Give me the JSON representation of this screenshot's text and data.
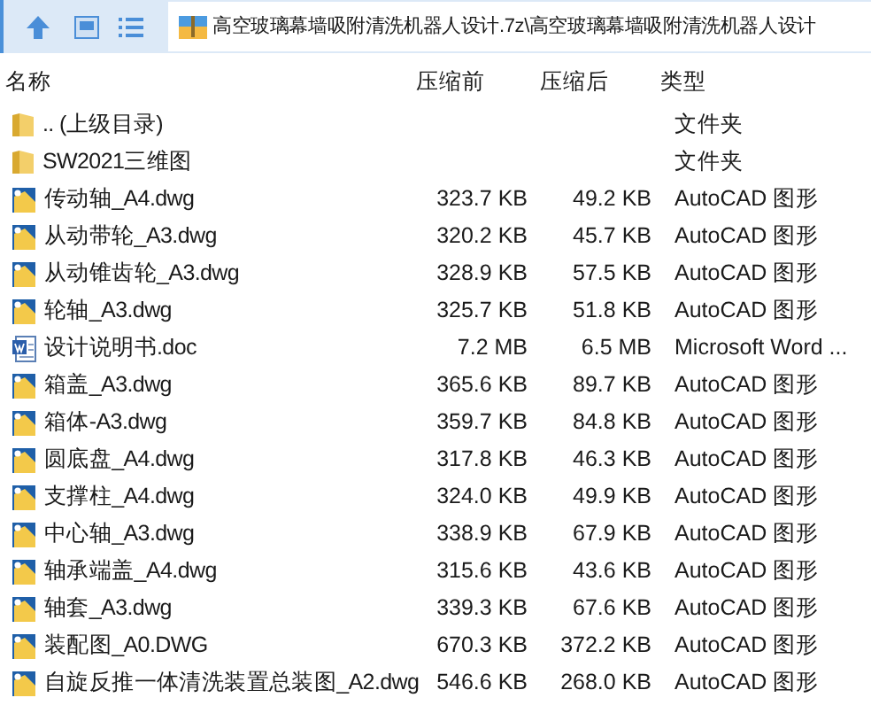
{
  "address": {
    "path": "高空玻璃幕墙吸附清洗机器人设计.7z\\高空玻璃幕墙吸附清洗机器人设计"
  },
  "columns": [
    "名称",
    "压缩前",
    "压缩后",
    "类型"
  ],
  "rows": [
    {
      "kind": "folder",
      "name": ".. (上级目录)",
      "size": "",
      "packed": "",
      "type": "文件夹"
    },
    {
      "kind": "folder",
      "name": "SW2021三维图",
      "size": "",
      "packed": "",
      "type": "文件夹"
    },
    {
      "kind": "dwg",
      "name": "传动轴_A4.dwg",
      "size": "323.7 KB",
      "packed": "49.2 KB",
      "type": "AutoCAD 图形"
    },
    {
      "kind": "dwg",
      "name": "从动带轮_A3.dwg",
      "size": "320.2 KB",
      "packed": "45.7 KB",
      "type": "AutoCAD 图形"
    },
    {
      "kind": "dwg",
      "name": "从动锥齿轮_A3.dwg",
      "size": "328.9 KB",
      "packed": "57.5 KB",
      "type": "AutoCAD 图形"
    },
    {
      "kind": "dwg",
      "name": "轮轴_A3.dwg",
      "size": "325.7 KB",
      "packed": "51.8 KB",
      "type": "AutoCAD 图形"
    },
    {
      "kind": "doc",
      "name": "设计说明书.doc",
      "size": "7.2 MB",
      "packed": "6.5 MB",
      "type": "Microsoft Word ..."
    },
    {
      "kind": "dwg",
      "name": "箱盖_A3.dwg",
      "size": "365.6 KB",
      "packed": "89.7 KB",
      "type": "AutoCAD 图形"
    },
    {
      "kind": "dwg",
      "name": "箱体-A3.dwg",
      "size": "359.7 KB",
      "packed": "84.8 KB",
      "type": "AutoCAD 图形"
    },
    {
      "kind": "dwg",
      "name": "圆底盘_A4.dwg",
      "size": "317.8 KB",
      "packed": "46.3 KB",
      "type": "AutoCAD 图形"
    },
    {
      "kind": "dwg",
      "name": "支撑柱_A4.dwg",
      "size": "324.0 KB",
      "packed": "49.9 KB",
      "type": "AutoCAD 图形"
    },
    {
      "kind": "dwg",
      "name": "中心轴_A3.dwg",
      "size": "338.9 KB",
      "packed": "67.9 KB",
      "type": "AutoCAD 图形"
    },
    {
      "kind": "dwg",
      "name": "轴承端盖_A4.dwg",
      "size": "315.6 KB",
      "packed": "43.6 KB",
      "type": "AutoCAD 图形"
    },
    {
      "kind": "dwg",
      "name": "轴套_A3.dwg",
      "size": "339.3 KB",
      "packed": "67.6 KB",
      "type": "AutoCAD 图形"
    },
    {
      "kind": "dwg",
      "name": "装配图_A0.DWG",
      "size": "670.3 KB",
      "packed": "372.2 KB",
      "type": "AutoCAD 图形"
    },
    {
      "kind": "dwg",
      "name": "自旋反推一体清洗装置总装图_A2.dwg",
      "size": "546.6 KB",
      "packed": "268.0 KB",
      "type": "AutoCAD 图形"
    }
  ]
}
